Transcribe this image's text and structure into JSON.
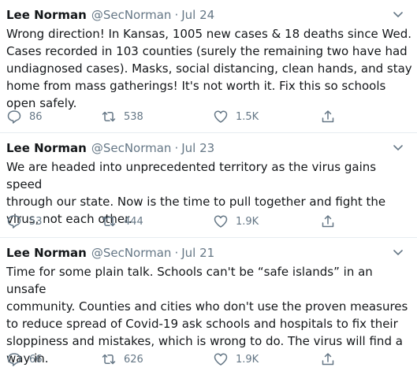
{
  "tweets": [
    {
      "name": "Lee Norman",
      "handle": "@SecNorman",
      "separator": "·",
      "date": "Jul 24",
      "text": "Wrong direction! In Kansas, 1005 new cases & 18 deaths since Wed.\nCases recorded in 103 counties (surely the remaining two have had\nundiagnosed cases). Masks, social distancing, clean hands, and stay\nhome from mass gatherings! It's not worth it. Fix this so schools\nopen safely.",
      "replies": "86",
      "retweets": "538",
      "likes": "1.5K"
    },
    {
      "name": "Lee Norman",
      "handle": "@SecNorman",
      "separator": "·",
      "date": "Jul 23",
      "text": "We are headed into unprecedented territory as the virus gains speed\nthrough our state. Now is the time to pull together and fight the\nvirus, not each other.",
      "replies": "53",
      "retweets": "444",
      "likes": "1.9K"
    },
    {
      "name": "Lee Norman",
      "handle": "@SecNorman",
      "separator": "·",
      "date": "Jul 21",
      "text": "Time for some plain talk. Schools can't be “safe islands” in an unsafe\ncommunity. Counties and cities who don't use the proven measures\nto reduce spread of Covid-19 ask schools and hospitals to fix their\nsloppiness and mistakes, which is wrong to do. The virus will find a\nway in.",
      "replies": "66",
      "retweets": "626",
      "likes": "1.9K"
    }
  ],
  "icons": {
    "reply": "speech-bubble-icon",
    "retweet": "retweet-arrows-icon",
    "like": "heart-outline-icon",
    "share": "share-upload-icon",
    "more": "chevron-down-icon"
  },
  "colors": {
    "text": "#14171a",
    "secondary": "#657786",
    "divider": "#e6ecf0"
  }
}
